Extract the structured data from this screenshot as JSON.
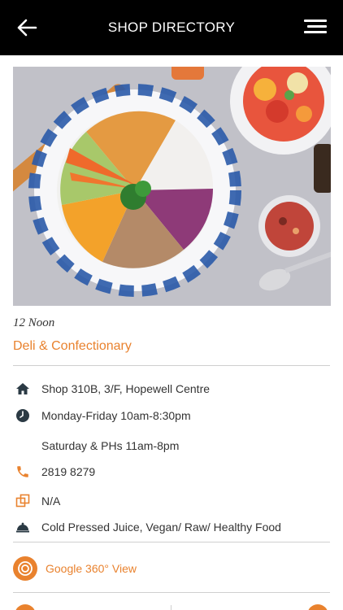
{
  "header": {
    "title": "SHOP DIRECTORY",
    "back_icon": "arrow-left-icon",
    "menu_icon": "hamburger-menu-icon"
  },
  "shop": {
    "name": "12 Noon",
    "category": "Deli & Confectionary",
    "address": "Shop 310B, 3/F, Hopewell Centre",
    "hours_weekday": "Monday-Friday 10am-8:30pm",
    "hours_weekend": "Saturday & PHs 11am-8pm",
    "phone": "2819 8279",
    "website": "N/A",
    "tags": "Cold Pressed Juice, Vegan/ Raw/ Healthy Food"
  },
  "google360": {
    "label": "Google 360° View"
  },
  "colors": {
    "accent": "#e9822e",
    "header_bg": "#000000",
    "icon_dark": "#2b3a44"
  }
}
